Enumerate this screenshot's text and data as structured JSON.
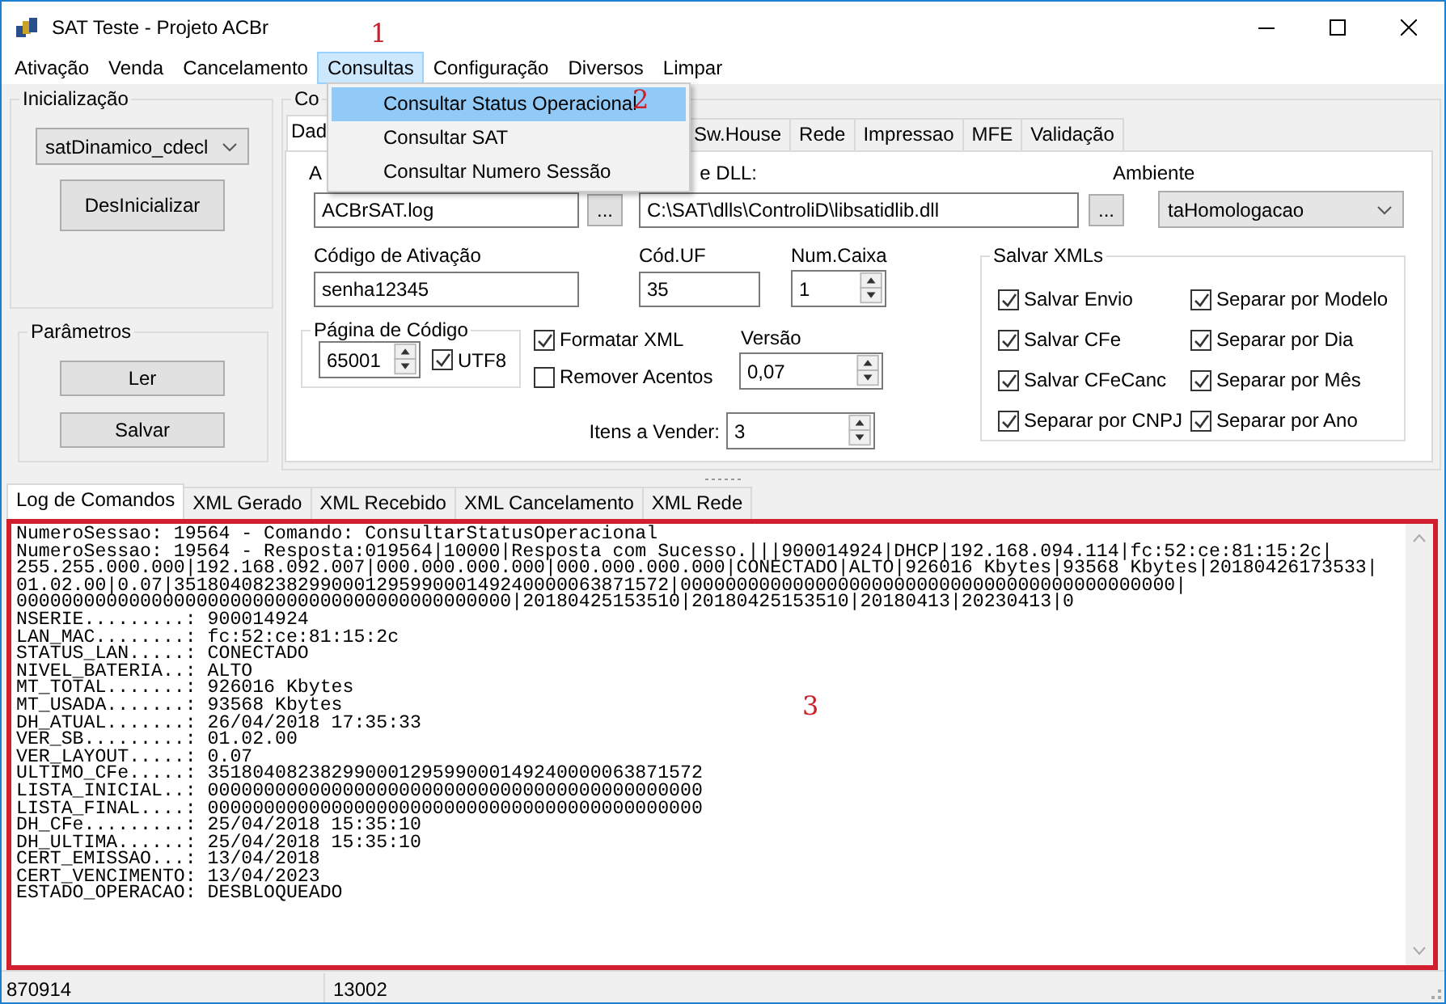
{
  "window": {
    "title": "SAT Teste - Projeto ACBr"
  },
  "menu_bar": [
    {
      "label": "Ativação",
      "selected": false
    },
    {
      "label": "Venda",
      "selected": false
    },
    {
      "label": "Cancelamento",
      "selected": false
    },
    {
      "label": "Consultas",
      "selected": true
    },
    {
      "label": "Configuração",
      "selected": false
    },
    {
      "label": "Diversos",
      "selected": false
    },
    {
      "label": "Limpar",
      "selected": false
    }
  ],
  "open_menu": {
    "items": [
      {
        "label": "Consultar Status Operacional",
        "selected": true
      },
      {
        "label": "Consultar SAT",
        "selected": false
      },
      {
        "label": "Consultar Numero Sessão",
        "selected": false
      }
    ]
  },
  "annotations": [
    {
      "label": "1"
    },
    {
      "label": "2"
    },
    {
      "label": "3"
    }
  ],
  "inicializacao": {
    "title": "Inicialização",
    "model": "satDinamico_cdecl",
    "button": "DesInicializar"
  },
  "parametros": {
    "title": "Parâmetros",
    "buttons": [
      "Ler",
      "Salvar"
    ]
  },
  "config": {
    "title": "Co",
    "tabs": [
      {
        "label": "Dad",
        "selected": true
      },
      {
        "label": "Sw.House",
        "selected": false
      },
      {
        "label": "Rede",
        "selected": false
      },
      {
        "label": "Impressao",
        "selected": false
      },
      {
        "label": "MFE",
        "selected": false
      },
      {
        "label": "Validação",
        "selected": false
      }
    ],
    "log_file": {
      "label": "A",
      "value": "ACBrSAT.log",
      "browse": "..."
    },
    "dll": {
      "label": "e DLL:",
      "value": "C:\\SAT\\dlls\\ControliD\\libsatidlib.dll",
      "browse": "..."
    },
    "ambiente": {
      "label": "Ambiente",
      "value": "taHomologacao"
    },
    "codigo_ativacao": {
      "label": "Código de Ativação",
      "value": "senha12345"
    },
    "cod_uf": {
      "label": "Cód.UF",
      "value": "35"
    },
    "num_caixa": {
      "label": "Num.Caixa",
      "value": "1"
    },
    "pagina_codigo": {
      "title": "Página de Código",
      "value": "65001",
      "utf8": {
        "label": "UTF8",
        "checked": true
      }
    },
    "options": [
      {
        "label": "Formatar XML",
        "checked": true
      },
      {
        "label": "Remover Acentos",
        "checked": false
      }
    ],
    "versao": {
      "label": "Versão",
      "value": "0,07"
    },
    "itens_vender": {
      "label": "Itens a Vender:",
      "value": "3"
    },
    "salvar_xmls": {
      "title": "Salvar XMLs",
      "options": [
        {
          "label": "Salvar Envio",
          "checked": true
        },
        {
          "label": "Separar por Modelo",
          "checked": true
        },
        {
          "label": "Salvar CFe",
          "checked": true
        },
        {
          "label": "Separar por Dia",
          "checked": true
        },
        {
          "label": "Salvar CFeCanc",
          "checked": true
        },
        {
          "label": "Separar por Mês",
          "checked": true
        },
        {
          "label": "Separar por CNPJ",
          "checked": true
        },
        {
          "label": "Separar por Ano",
          "checked": true
        }
      ]
    }
  },
  "log": {
    "tabs": [
      {
        "label": "Log de Comandos",
        "selected": true
      },
      {
        "label": "XML Gerado",
        "selected": false
      },
      {
        "label": "XML Recebido",
        "selected": false
      },
      {
        "label": "XML Cancelamento",
        "selected": false
      },
      {
        "label": "XML Rede",
        "selected": false
      }
    ],
    "lines": [
      "NumeroSessao: 19564 - Comando: ConsultarStatusOperacional",
      "NumeroSessao: 19564 - Resposta:019564|10000|Resposta com Sucesso.|||900014924|DHCP|192.168.094.114|fc:52:ce:81:15:2c|",
      "255.255.000.000|192.168.092.007|000.000.000.000|000.000.000.000|CONECTADO|ALTO|926016 Kbytes|93568 Kbytes|20180426173533|",
      "01.02.00|0.07|35180408238299000129599000149240000063871572|00000000000000000000000000000000000000000000|",
      "00000000000000000000000000000000000000000000|20180425153510|20180425153510|20180413|20230413|0",
      "NSERIE.........: 900014924",
      "LAN_MAC........: fc:52:ce:81:15:2c",
      "STATUS_LAN.....: CONECTADO",
      "NIVEL_BATERIA..: ALTO",
      "MT_TOTAL.......: 926016 Kbytes",
      "MT_USADA.......: 93568 Kbytes",
      "DH_ATUAL.......: 26/04/2018 17:35:33",
      "VER_SB.........: 01.02.00",
      "VER_LAYOUT.....: 0.07",
      "ULTIMO_CFe.....: 35180408238299000129599000149240000063871572",
      "LISTA_INICIAL..: 00000000000000000000000000000000000000000000",
      "LISTA_FINAL....: 00000000000000000000000000000000000000000000",
      "DH_CFe.........: 25/04/2018 15:35:10",
      "DH_ULTIMA......: 25/04/2018 15:35:10",
      "CERT_EMISSAO...: 13/04/2018",
      "CERT_VENCIMENTO: 13/04/2023",
      "ESTADO_OPERACAO: DESBLOQUEADO"
    ]
  },
  "status_bar": [
    "870914",
    "13002"
  ]
}
